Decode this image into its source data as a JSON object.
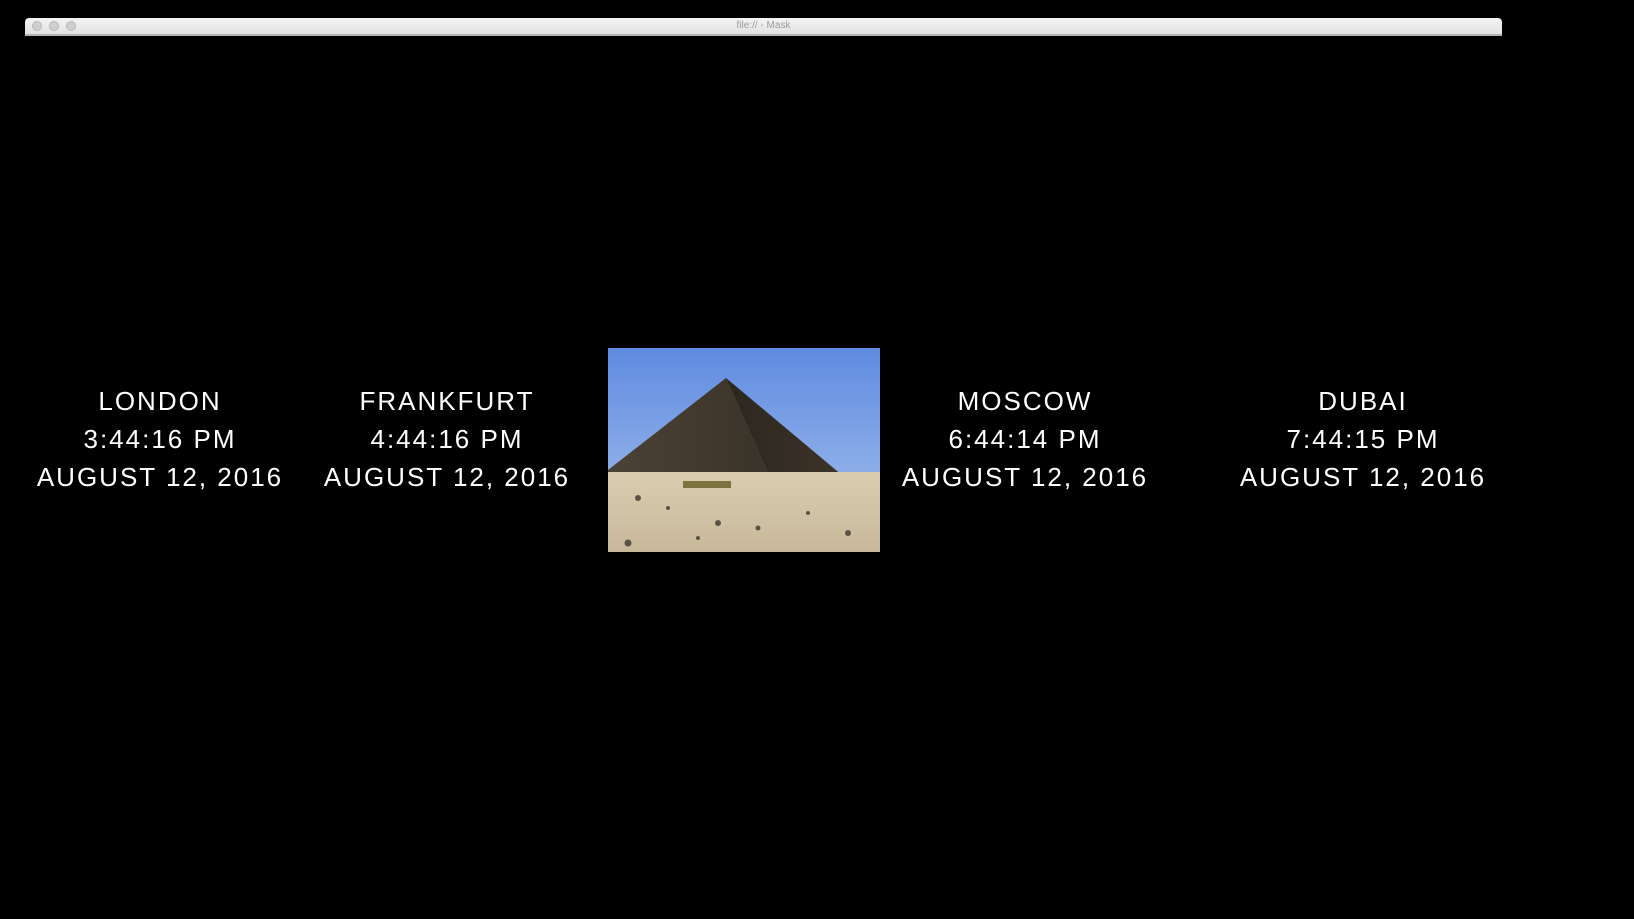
{
  "window": {
    "title": "file:// - Mask"
  },
  "clocks": [
    {
      "city": "LONDON",
      "time": "3:44:16 PM",
      "date": "AUGUST 12, 2016"
    },
    {
      "city": "FRANKFURT",
      "time": "4:44:16 PM",
      "date": "AUGUST 12, 2016"
    },
    {
      "city": "MOSCOW",
      "time": "6:44:14 PM",
      "date": "AUGUST 12, 2016"
    },
    {
      "city": "DUBAI",
      "time": "7:44:15 PM",
      "date": "AUGUST 12, 2016"
    }
  ],
  "photo": {
    "subject": "pyramid-photo"
  },
  "colors": {
    "background": "#000000",
    "text": "#ffffff"
  }
}
